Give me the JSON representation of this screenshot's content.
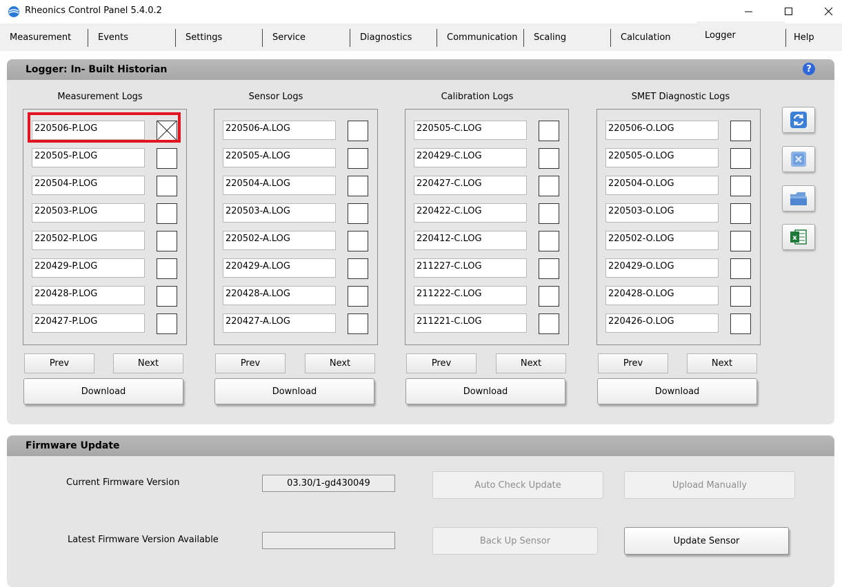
{
  "window": {
    "title": "Rheonics Control Panel 5.4.0.2",
    "controls": [
      "minimize",
      "maximize",
      "close"
    ]
  },
  "tabs": [
    {
      "label": "Measurement"
    },
    {
      "label": "Events"
    },
    {
      "label": "Settings"
    },
    {
      "label": "Service"
    },
    {
      "label": "Diagnostics"
    },
    {
      "label": "Communication"
    },
    {
      "label": "Scaling"
    },
    {
      "label": "Calculation"
    },
    {
      "label": "Logger",
      "active": true
    },
    {
      "label": "Help"
    }
  ],
  "logger": {
    "title": "Logger: In- Built Historian",
    "help_icon": "?",
    "groups": [
      {
        "title": "Measurement Logs",
        "files": [
          "220506-P.LOG",
          "220505-P.LOG",
          "220504-P.LOG",
          "220503-P.LOG",
          "220502-P.LOG",
          "220429-P.LOG",
          "220428-P.LOG",
          "220427-P.LOG"
        ],
        "checked": [
          true,
          false,
          false,
          false,
          false,
          false,
          false,
          false
        ]
      },
      {
        "title": "Sensor Logs",
        "files": [
          "220506-A.LOG",
          "220505-A.LOG",
          "220504-A.LOG",
          "220503-A.LOG",
          "220502-A.LOG",
          "220429-A.LOG",
          "220428-A.LOG",
          "220427-A.LOG"
        ],
        "checked": [
          false,
          false,
          false,
          false,
          false,
          false,
          false,
          false
        ]
      },
      {
        "title": "Calibration Logs",
        "files": [
          "220505-C.LOG",
          "220429-C.LOG",
          "220427-C.LOG",
          "220422-C.LOG",
          "220412-C.LOG",
          "211227-C.LOG",
          "211222-C.LOG",
          "211221-C.LOG"
        ],
        "checked": [
          false,
          false,
          false,
          false,
          false,
          false,
          false,
          false
        ]
      },
      {
        "title": "SMET Diagnostic Logs",
        "files": [
          "220506-O.LOG",
          "220505-O.LOG",
          "220504-O.LOG",
          "220503-O.LOG",
          "220502-O.LOG",
          "220429-O.LOG",
          "220428-O.LOG",
          "220426-O.LOG"
        ],
        "checked": [
          false,
          false,
          false,
          false,
          false,
          false,
          false,
          false
        ]
      }
    ],
    "prev_label": "Prev",
    "next_label": "Next",
    "download_label": "Download",
    "side_icons": [
      "refresh-icon",
      "delete-icon",
      "open-folder-icon",
      "excel-icon"
    ]
  },
  "firmware": {
    "title": "Firmware Update",
    "current_label": "Current Firmware Version",
    "current_value": "03.30/1-gd430049",
    "latest_label": "Latest Firmware Version Available",
    "latest_value": "",
    "auto_check_label": "Auto Check Update",
    "upload_label": "Upload Manually",
    "backup_label": "Back Up Sensor",
    "update_label": "Update Sensor"
  },
  "colors": {
    "highlight": "#e0151f",
    "panel_bg": "#e5e5e5",
    "panel_header": "#afafaf",
    "help_blue": "#2f67d8",
    "excel_green": "#1f7a3a"
  }
}
